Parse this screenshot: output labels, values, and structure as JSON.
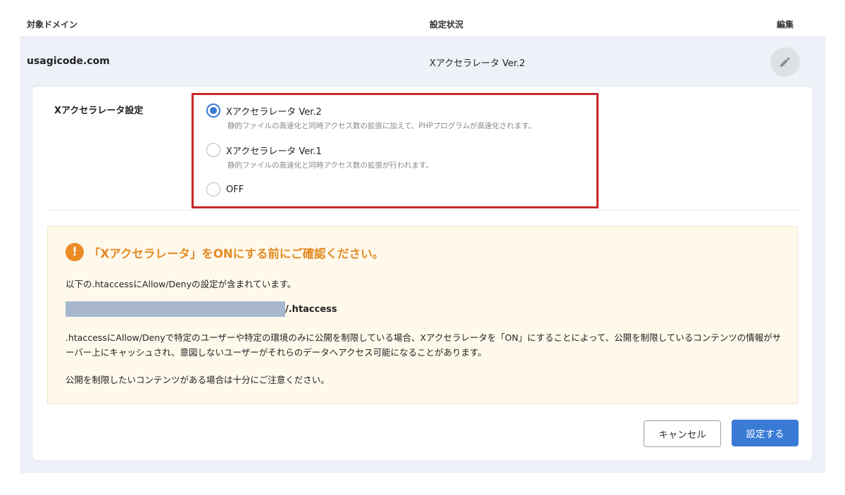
{
  "table": {
    "headers": {
      "domain": "対象ドメイン",
      "status": "設定状況",
      "edit": "編集"
    },
    "row": {
      "domain": "usagicode.com",
      "status": "Xアクセラレータ Ver.2"
    }
  },
  "setting": {
    "label": "Xアクセラレータ設定",
    "options": [
      {
        "label": "Xアクセラレータ Ver.2",
        "description": "静的ファイルの高速化と同時アクセス数の拡張に加えて、PHPプログラムが高速化されます。",
        "checked": true
      },
      {
        "label": "Xアクセラレータ Ver.1",
        "description": "静的ファイルの高速化と同時アクセス数の拡張が行われます。",
        "checked": false
      },
      {
        "label": "OFF",
        "description": "",
        "checked": false
      }
    ]
  },
  "warning": {
    "title": "「Xアクセラレータ」をONにする前にご確認ください。",
    "line1": "以下の.htaccessにAllow/Denyの設定が含まれています。",
    "path_suffix": "/.htaccess",
    "paragraph": ".htaccessにAllow/Denyで特定のユーザーや特定の環境のみに公開を制限している場合、Xアクセラレータを「ON」にすることによって、公開を制限しているコンテンツの情報がサーバー上にキャッシュされ、意図しないユーザーがそれらのデータへアクセス可能になることがあります。",
    "last": "公開を制限したいコンテンツがある場合は十分にご注意ください。"
  },
  "buttons": {
    "cancel": "キャンセル",
    "submit": "設定する"
  },
  "colors": {
    "accent": "#3a7bd6",
    "warning": "#e38a24",
    "highlight": "#c7282b"
  },
  "icons": {
    "edit": "pencil-icon",
    "warning": "exclamation-icon"
  }
}
